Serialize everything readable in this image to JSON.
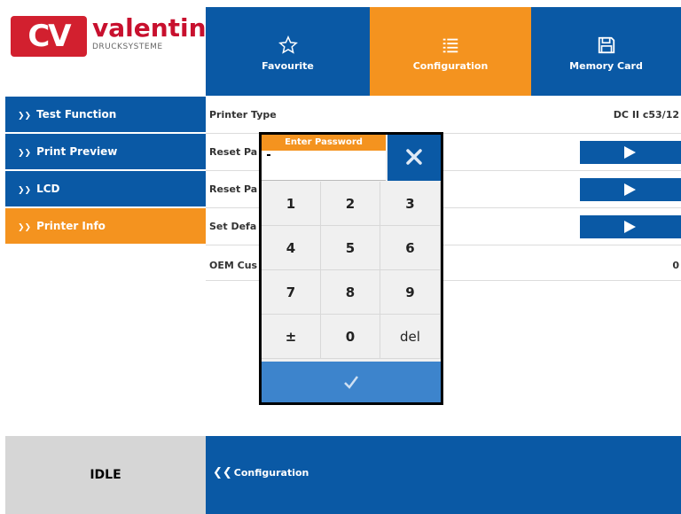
{
  "logo": {
    "brand": "valentin",
    "sub": "DRUCKSYSTEME",
    "mark": "CV"
  },
  "top_tabs": [
    {
      "label": "Favourite",
      "icon": "star-icon"
    },
    {
      "label": "Configuration",
      "icon": "list-icon"
    },
    {
      "label": "Memory Card",
      "icon": "save-icon"
    }
  ],
  "sidebar": [
    {
      "label": "Test Function",
      "active": false
    },
    {
      "label": "Print Preview",
      "active": false
    },
    {
      "label": "LCD",
      "active": false
    },
    {
      "label": "Printer Info",
      "active": true
    }
  ],
  "rows": [
    {
      "label": "Printer Type",
      "value": "DC II c53/12"
    },
    {
      "label": "Reset Pa",
      "value": ""
    },
    {
      "label": "Reset Pa",
      "value": ""
    },
    {
      "label": "Set Defa",
      "value": ""
    },
    {
      "label": "OEM Cus",
      "value": "0"
    }
  ],
  "status": "IDLE",
  "back": {
    "label": "Configuration"
  },
  "dialog": {
    "title": "Enter Password",
    "keys": [
      "1",
      "2",
      "3",
      "4",
      "5",
      "6",
      "7",
      "8",
      "9",
      "±",
      "0",
      "del"
    ]
  },
  "colors": {
    "blue": "#0a59a5",
    "orange": "#f4931f",
    "light_blue": "#3d84cc",
    "status_bg": "#d6d6d6"
  }
}
